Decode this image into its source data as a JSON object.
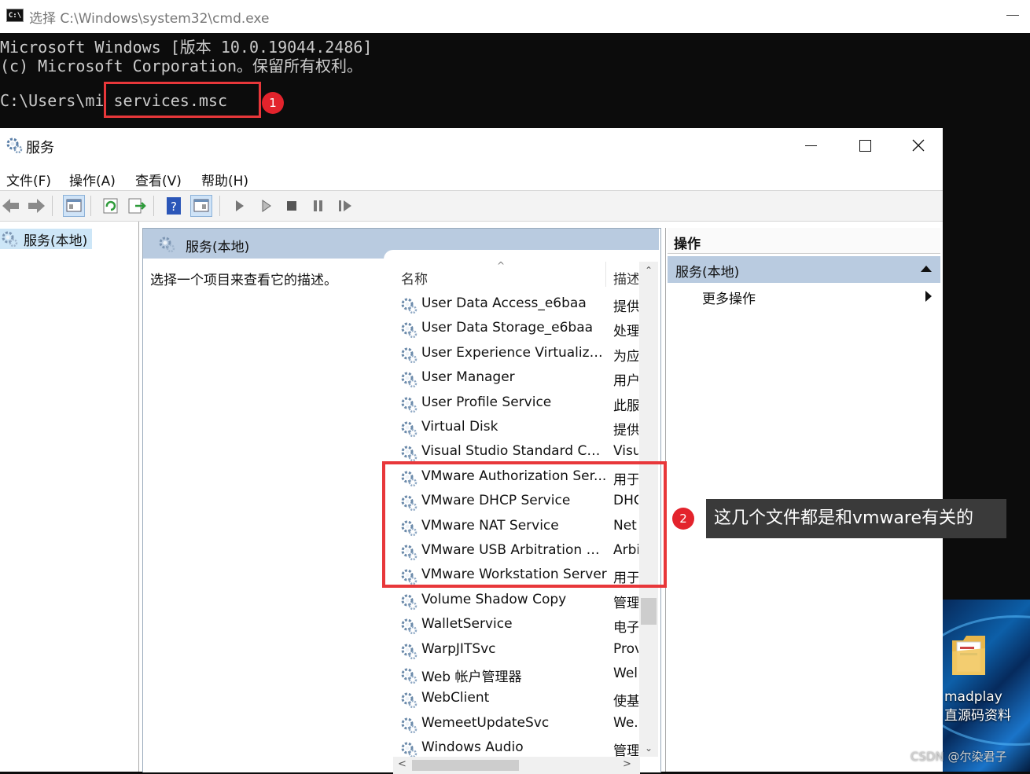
{
  "cmd": {
    "title": "选择 C:\\Windows\\system32\\cmd.exe",
    "icon": "C:\\",
    "lines": [
      "Microsoft Windows [版本 10.0.19044.2486]",
      "(c) Microsoft Corporation。保留所有权利。",
      "",
      "C:\\Users\\mi services.msc"
    ]
  },
  "services_window": {
    "title": "服务",
    "menu": [
      "文件(F)",
      "操作(A)",
      "查看(V)",
      "帮助(H)"
    ],
    "tree": {
      "item": "服务(本地)"
    },
    "center": {
      "header": "服务(本地)",
      "description_prompt": "选择一个项目来查看它的描述。",
      "columns": {
        "name": "名称",
        "description": "描述"
      },
      "sort_glyph": "^",
      "services": [
        {
          "name": "User Data Access_e6baa",
          "desc": "提供"
        },
        {
          "name": "User Data Storage_e6baa",
          "desc": "处理"
        },
        {
          "name": "User Experience Virtualizat...",
          "desc": "为应"
        },
        {
          "name": "User Manager",
          "desc": "用户"
        },
        {
          "name": "User Profile Service",
          "desc": "此服"
        },
        {
          "name": "Virtual Disk",
          "desc": "提供"
        },
        {
          "name": "Visual Studio Standard Coll...",
          "desc": "Visu"
        },
        {
          "name": "VMware Authorization Ser...",
          "desc": "用于"
        },
        {
          "name": "VMware DHCP Service",
          "desc": "DHC"
        },
        {
          "name": "VMware NAT Service",
          "desc": "Net"
        },
        {
          "name": "VMware USB Arbitration S...",
          "desc": "Arbi"
        },
        {
          "name": "VMware Workstation Server",
          "desc": "用于"
        },
        {
          "name": "Volume Shadow Copy",
          "desc": "管理"
        },
        {
          "name": "WalletService",
          "desc": "电子"
        },
        {
          "name": "WarpJITSvc",
          "desc": "Prov"
        },
        {
          "name": "Web 帐户管理器",
          "desc": "Wel"
        },
        {
          "name": "WebClient",
          "desc": "使基"
        },
        {
          "name": "WemeetUpdateSvc",
          "desc": "We."
        },
        {
          "name": "Windows Audio",
          "desc": "管理"
        }
      ]
    },
    "actions": {
      "title": "操作",
      "section": "服务(本地)",
      "more": "更多操作"
    }
  },
  "annotations": {
    "badge1": "1",
    "badge2": "2",
    "note2": "这几个文件都是和vmware有关的"
  },
  "desktop": {
    "icon_label_line1": "madplay",
    "icon_label_line2": "直源码资料"
  },
  "watermark": "CSDN @尔染君子",
  "colors": {
    "annotation_red": "#e8373a",
    "header_blue": "#b9cbe0",
    "selection_blue": "#cde6f7",
    "console_bg": "#0c0c0c"
  }
}
